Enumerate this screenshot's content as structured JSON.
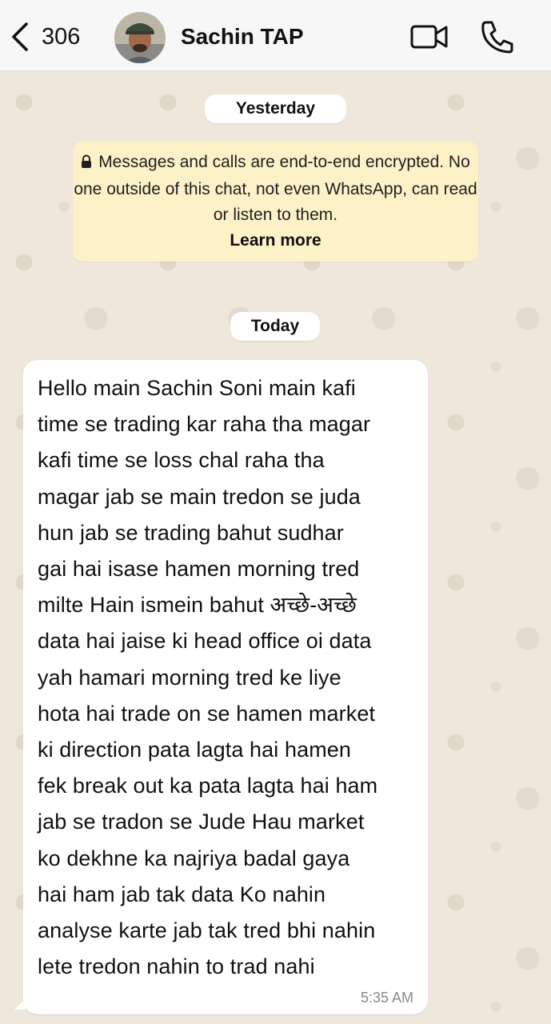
{
  "header": {
    "back_count": "306",
    "contact_name": "Sachin TAP",
    "avatar_icon": "avatar",
    "video_icon": "video-call-icon",
    "call_icon": "phone-icon",
    "back_icon": "chevron-left-icon"
  },
  "chat": {
    "date_yesterday": "Yesterday",
    "encryption_notice": "Messages and calls are end-to-end encrypted. No one outside of this chat, not even WhatsApp, can read or listen to them.",
    "encryption_link": "Learn more",
    "date_today": "Today",
    "messages": [
      {
        "text": "Hello main Sachin Soni main kafi\ntime se trading kar raha tha magar\nkafi time se loss chal raha tha\nmagar jab se main tredon se juda\nhun jab se trading bahut sudhar\ngai hai isase hamen morning tred\nmilte Hain ismein bahut अच्छे-अच्छे\ndata hai jaise ki head office oi data\nyah hamari morning tred ke liye\nhota hai trade on se hamen market\nki direction pata lagta hai hamen\nfek break out ka pata lagta hai ham\njab se tradon se Jude Hau market\nko dekhne ka najriya badal gaya\nhai ham jab tak data Ko nahin\nanalyse karte jab tak tred bhi nahin\nlete tredon nahin to trad nahi",
        "time": "5:35 AM"
      }
    ]
  },
  "colors": {
    "header_bg": "#f7f7f7",
    "wallpaper": "#efe7dc",
    "encryption_bg": "#fdf1c8",
    "bubble_bg": "#ffffff"
  }
}
